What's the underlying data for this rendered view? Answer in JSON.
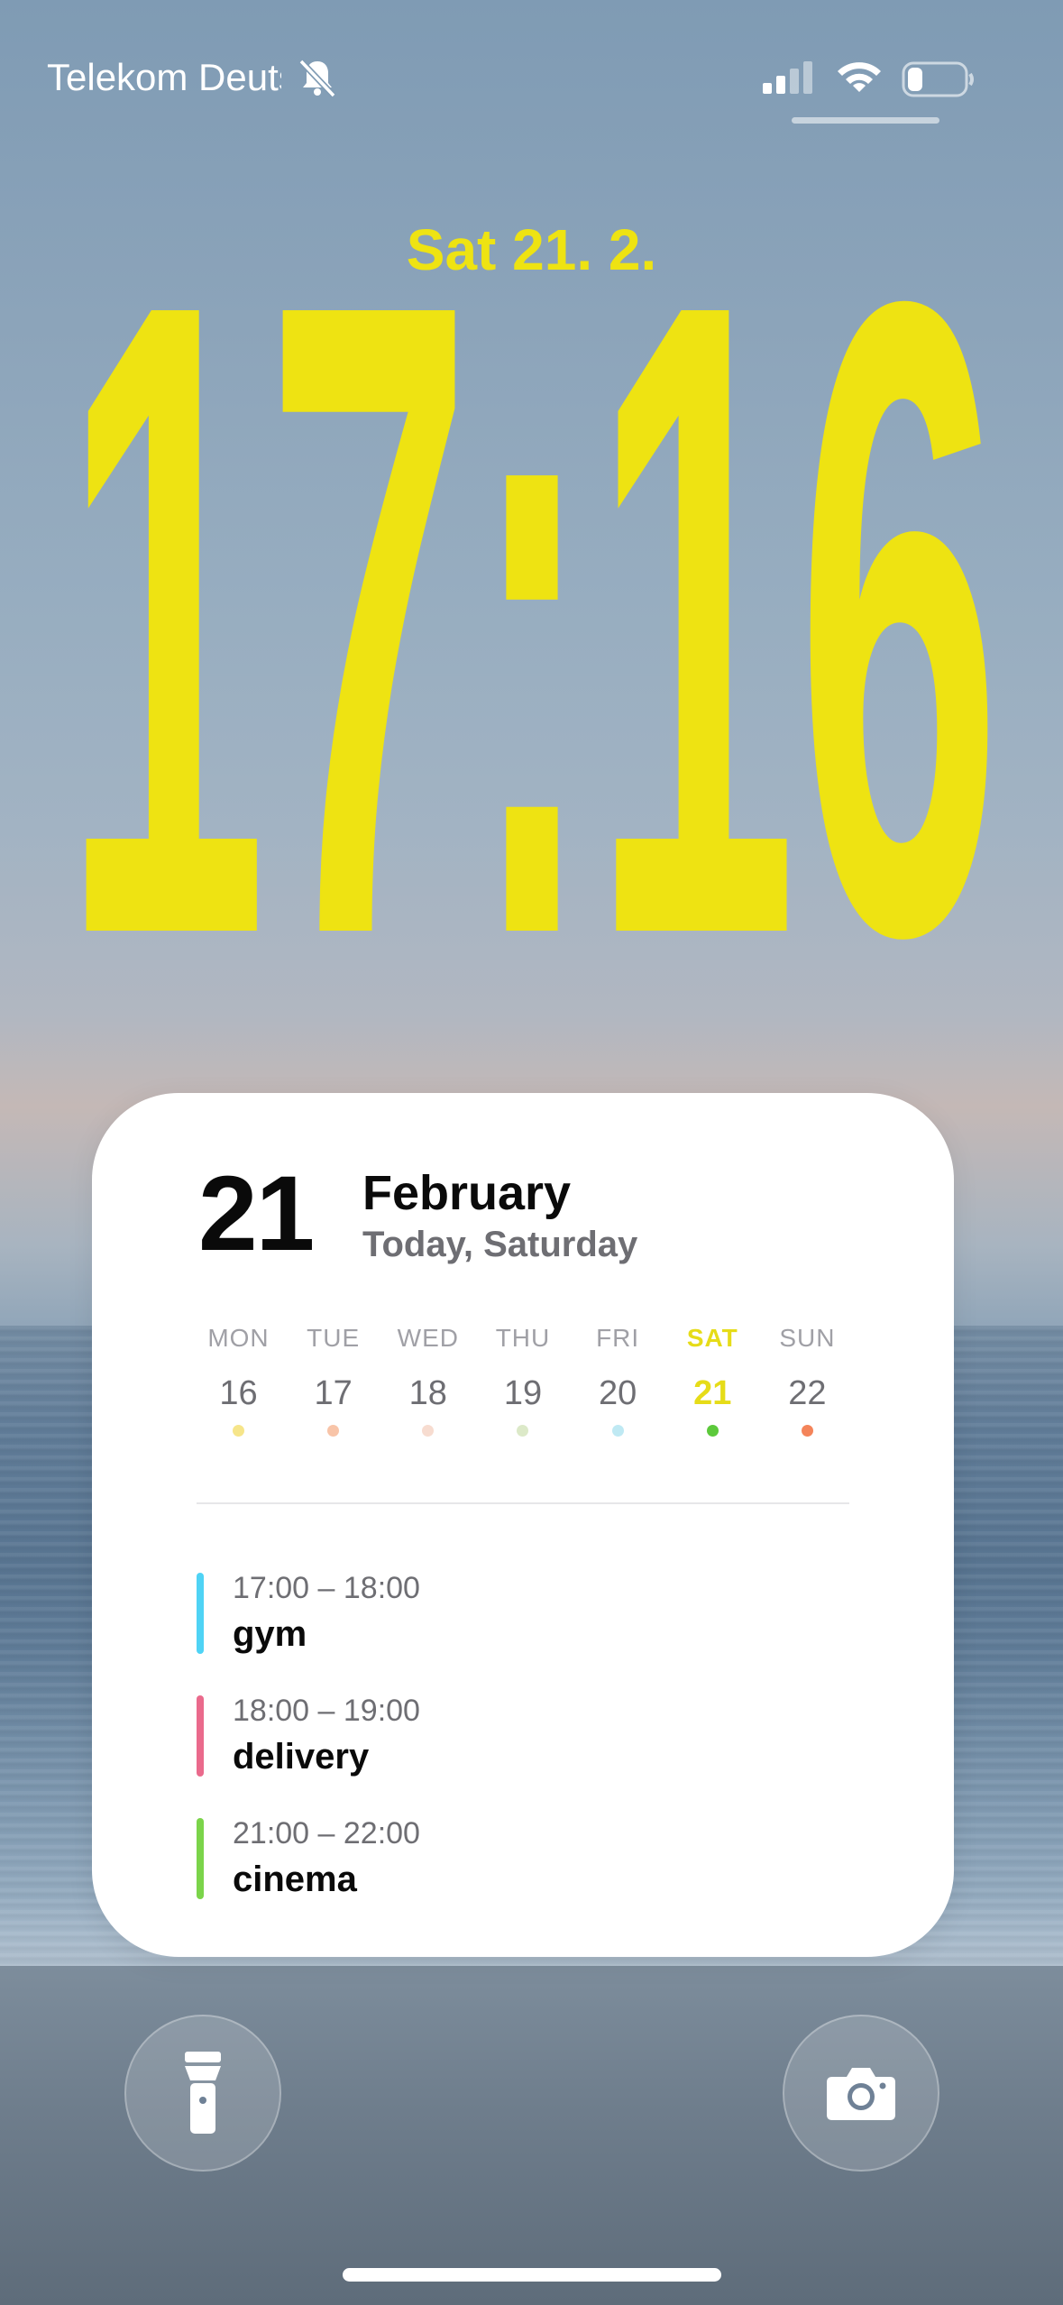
{
  "status_bar": {
    "carrier": "Telekom Deutschland",
    "icons": [
      "mute-bell-icon",
      "cellular-signal-icon",
      "wifi-icon",
      "battery-icon"
    ]
  },
  "lock_screen": {
    "date": "Sat 21. 2.",
    "time_hours": "17",
    "time_minutes": "16",
    "accent_color": "#eee312"
  },
  "widget": {
    "day_number": "21",
    "month": "February",
    "today_label": "Today, Saturday",
    "week": [
      {
        "name": "MON",
        "date": "16",
        "dot": "#f6e58a",
        "today": false
      },
      {
        "name": "TUE",
        "date": "17",
        "dot": "#f8c4a8",
        "today": false
      },
      {
        "name": "WED",
        "date": "18",
        "dot": "#f7dcd0",
        "today": false
      },
      {
        "name": "THU",
        "date": "19",
        "dot": "#dce9c8",
        "today": false
      },
      {
        "name": "FRI",
        "date": "20",
        "dot": "#bfe9f3",
        "today": false
      },
      {
        "name": "SAT",
        "date": "21",
        "dot": "#5cc93b",
        "today": true
      },
      {
        "name": "SUN",
        "date": "22",
        "dot": "#f4845a",
        "today": false
      }
    ],
    "events": [
      {
        "time": "17:00 – 18:00",
        "title": "gym",
        "color": "#4fd3f5"
      },
      {
        "time": "18:00 – 19:00",
        "title": "delivery",
        "color": "#ea6a8c"
      },
      {
        "time": "21:00 – 22:00",
        "title": "cinema",
        "color": "#7bd44a"
      }
    ]
  },
  "bottom": {
    "left_button_icon": "flashlight-icon",
    "right_button_icon": "camera-icon"
  }
}
